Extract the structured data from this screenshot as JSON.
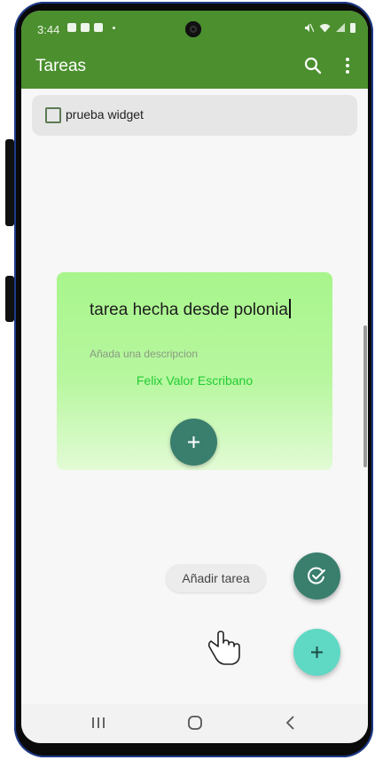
{
  "status_bar": {
    "time": "3:44"
  },
  "app_bar": {
    "title": "Tareas",
    "search_icon": "search-icon",
    "more_icon": "more-vert-icon"
  },
  "widget_item": {
    "label": "prueba widget",
    "checked": false
  },
  "task_dialog": {
    "title_value": "tarea hecha desde polonia",
    "description_placeholder": "Añada una descripcion",
    "author": "Felix Valor Escribano",
    "add_icon": "plus-icon"
  },
  "speed_dial": {
    "add_task_label": "Añadir tarea",
    "task_icon": "check-circle-icon",
    "main_icon": "plus-icon"
  },
  "nav_bar": {
    "recents_icon": "recents-icon",
    "home_icon": "home-icon",
    "back_icon": "back-icon"
  },
  "colors": {
    "app_bar": "#4b8f2e",
    "card_top": "#a8f58c",
    "fab_dark": "#3a7f6e",
    "fab_light": "#5fd8c4",
    "author_text": "#22cc33"
  }
}
